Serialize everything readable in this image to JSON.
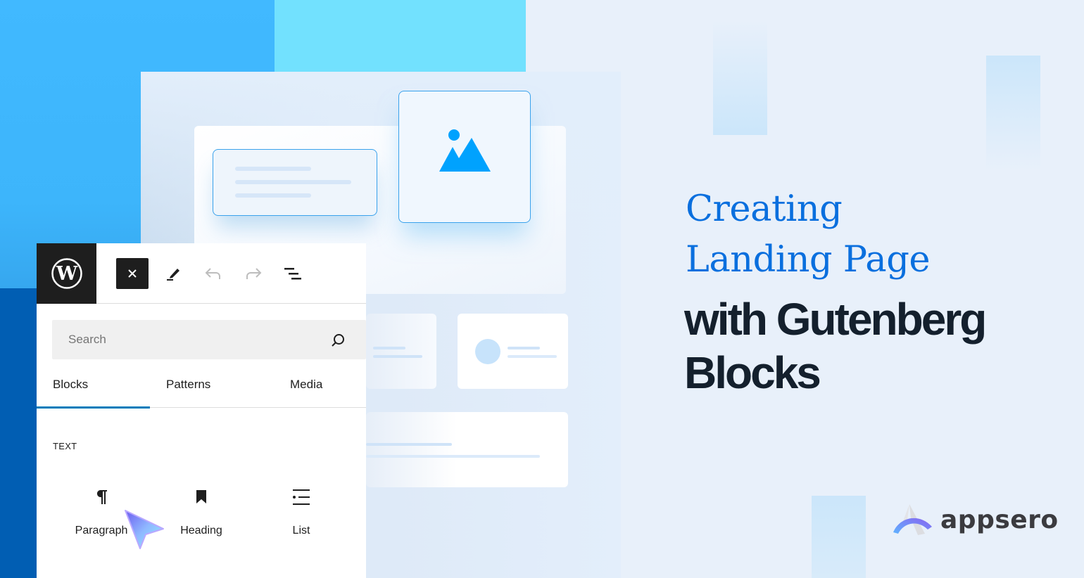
{
  "colors": {
    "accent_blue": "#0a6fde",
    "headline_dark": "#14202d",
    "image_icon_blue": "#00a2fe",
    "tab_active_underline": "#007cba",
    "wp_dark": "#1e1e1e"
  },
  "editor": {
    "toolbar": {
      "logo_icon": "wordpress-icon",
      "buttons": [
        {
          "name": "close",
          "icon": "close-icon",
          "glyph": "✕"
        },
        {
          "name": "tools",
          "icon": "pen-icon"
        },
        {
          "name": "undo",
          "icon": "undo-icon"
        },
        {
          "name": "redo",
          "icon": "redo-icon"
        },
        {
          "name": "document-overview",
          "icon": "list-view-icon"
        }
      ]
    },
    "search": {
      "placeholder": "Search",
      "value": "",
      "icon": "search-icon"
    },
    "tabs": [
      {
        "label": "Blocks",
        "active": true
      },
      {
        "label": "Patterns",
        "active": false
      },
      {
        "label": "Media",
        "active": false
      }
    ],
    "section_label": "TEXT",
    "blocks": [
      {
        "label": "Paragraph",
        "icon": "paragraph-icon"
      },
      {
        "label": "Heading",
        "icon": "bookmark-icon"
      },
      {
        "label": "List",
        "icon": "list-icon"
      }
    ]
  },
  "headline": {
    "line1": "Creating",
    "line2": "Landing Page",
    "line3": "with Gutenberg",
    "line4": "Blocks"
  },
  "brand": {
    "name": "appsero",
    "logo_icon": "appsero-logo-icon"
  }
}
